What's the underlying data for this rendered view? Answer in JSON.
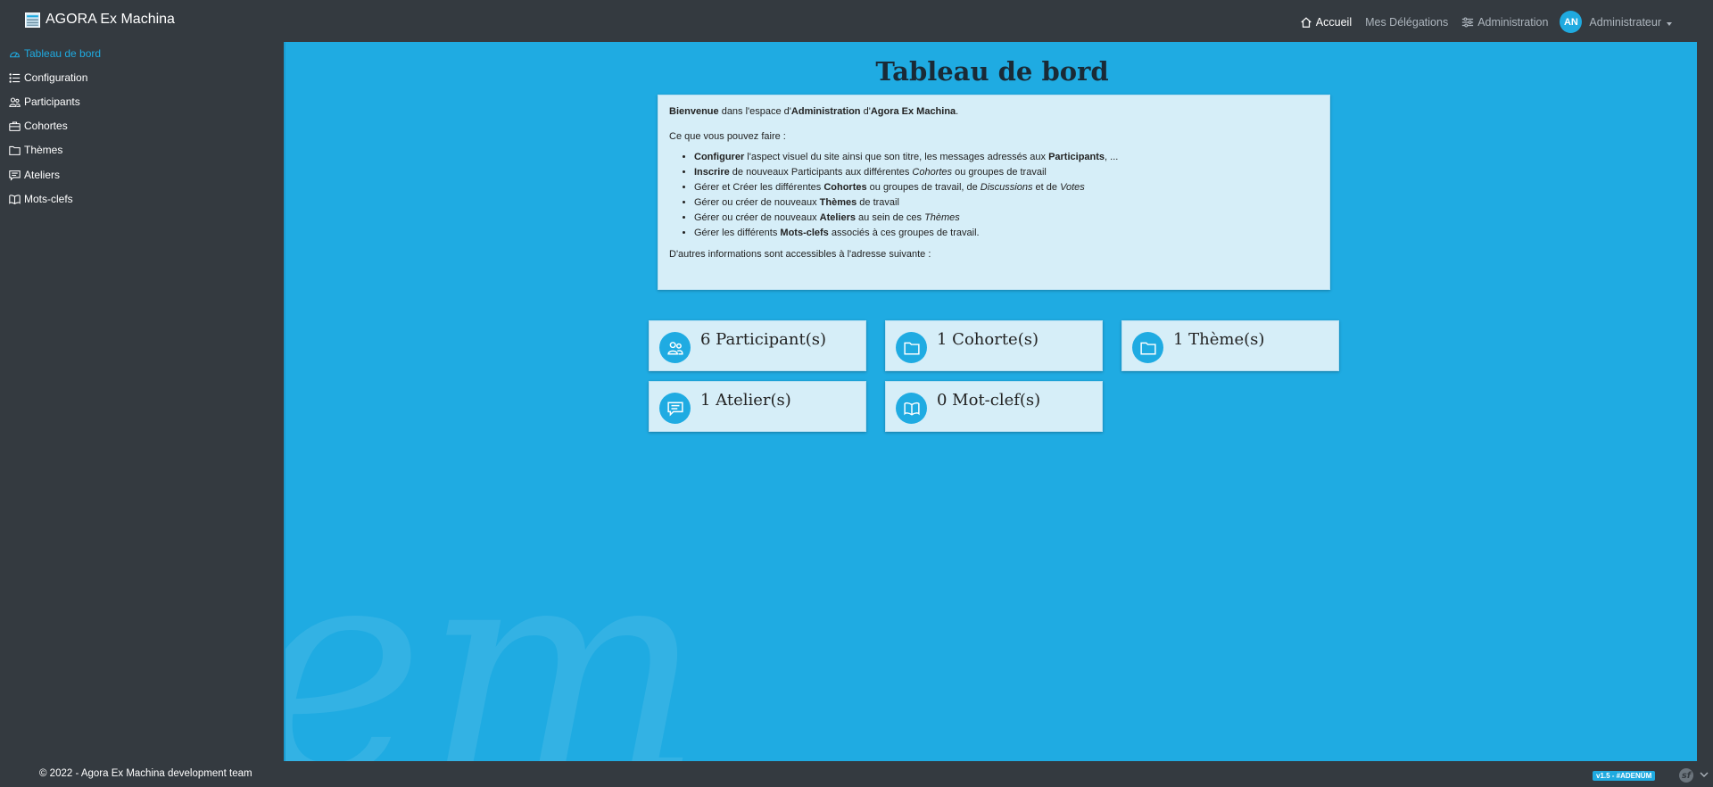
{
  "app": {
    "title": "AGORA Ex Machina"
  },
  "topnav": {
    "items": [
      {
        "label": "Accueil",
        "icon": "home-icon",
        "active": true
      },
      {
        "label": "Mes Délégations"
      },
      {
        "label": "Administration",
        "icon": "sliders-icon"
      }
    ],
    "user": {
      "initials": "AN",
      "name": "Administrateur"
    }
  },
  "sidebar": {
    "items": [
      {
        "label": "Tableau de bord",
        "icon": "dashboard-icon",
        "active": true
      },
      {
        "label": "Configuration",
        "icon": "list-icon"
      },
      {
        "label": "Participants",
        "icon": "people-icon"
      },
      {
        "label": "Cohortes",
        "icon": "briefcase-icon"
      },
      {
        "label": "Thèmes",
        "icon": "folder-icon"
      },
      {
        "label": "Ateliers",
        "icon": "chat-icon"
      },
      {
        "label": "Mots-clefs",
        "icon": "book-icon"
      }
    ]
  },
  "main": {
    "title": "Tableau de bord",
    "info": {
      "welcome": {
        "b1": "Bienvenue",
        "t1": " dans l'espace d'",
        "b2": "Administration",
        "t2": " d'",
        "b3": "Agora Ex Machina",
        "t3": "."
      },
      "intro": "Ce que vous pouvez faire :",
      "bullets": [
        {
          "b1": "Configurer",
          "t1": " l'aspect visuel du site ainsi que son titre, les messages adressés aux ",
          "b2": "Participants",
          "t2": ", ..."
        },
        {
          "b1": "Inscrire",
          "t1": " de nouveaux Participants aux différentes ",
          "i1": "Cohortes",
          "t2": " ou groupes de travail"
        },
        {
          "t0": "Gérer et Créer les différentes ",
          "b1": "Cohortes",
          "t1": " ou groupes de travail, de ",
          "i1": "Discussions",
          "t2": " et de ",
          "i2": "Votes"
        },
        {
          "t0": "Gérer ou créer de nouveaux ",
          "b1": "Thèmes",
          "t1": " de travail"
        },
        {
          "t0": "Gérer ou créer de nouveaux ",
          "b1": "Ateliers",
          "t1": " au sein de ces ",
          "i1": "Thèmes"
        },
        {
          "t0": "Gérer les différents ",
          "b1": "Mots-clefs",
          "t1": " associés à ces groupes de travail."
        }
      ],
      "more": "D'autres informations sont accessibles à l'adresse suivante :"
    },
    "stats": [
      {
        "label": "6 Participant(s)",
        "icon": "people-icon"
      },
      {
        "label": "1 Cohorte(s)",
        "icon": "folder-icon"
      },
      {
        "label": "1 Thème(s)",
        "icon": "folder-icon"
      },
      {
        "label": "1 Atelier(s)",
        "icon": "chat-icon"
      },
      {
        "label": "0 Mot-clef(s)",
        "icon": "book-icon"
      }
    ],
    "watermark": "em"
  },
  "footer": {
    "copyright": "© 2022 - Agora Ex Machina development team",
    "version": "v1.5 - #ADENÜM"
  },
  "colors": {
    "accent": "#1faae0",
    "main_bg": "#1fabe2",
    "panel": "#d6eef8",
    "dark": "#343a40"
  }
}
